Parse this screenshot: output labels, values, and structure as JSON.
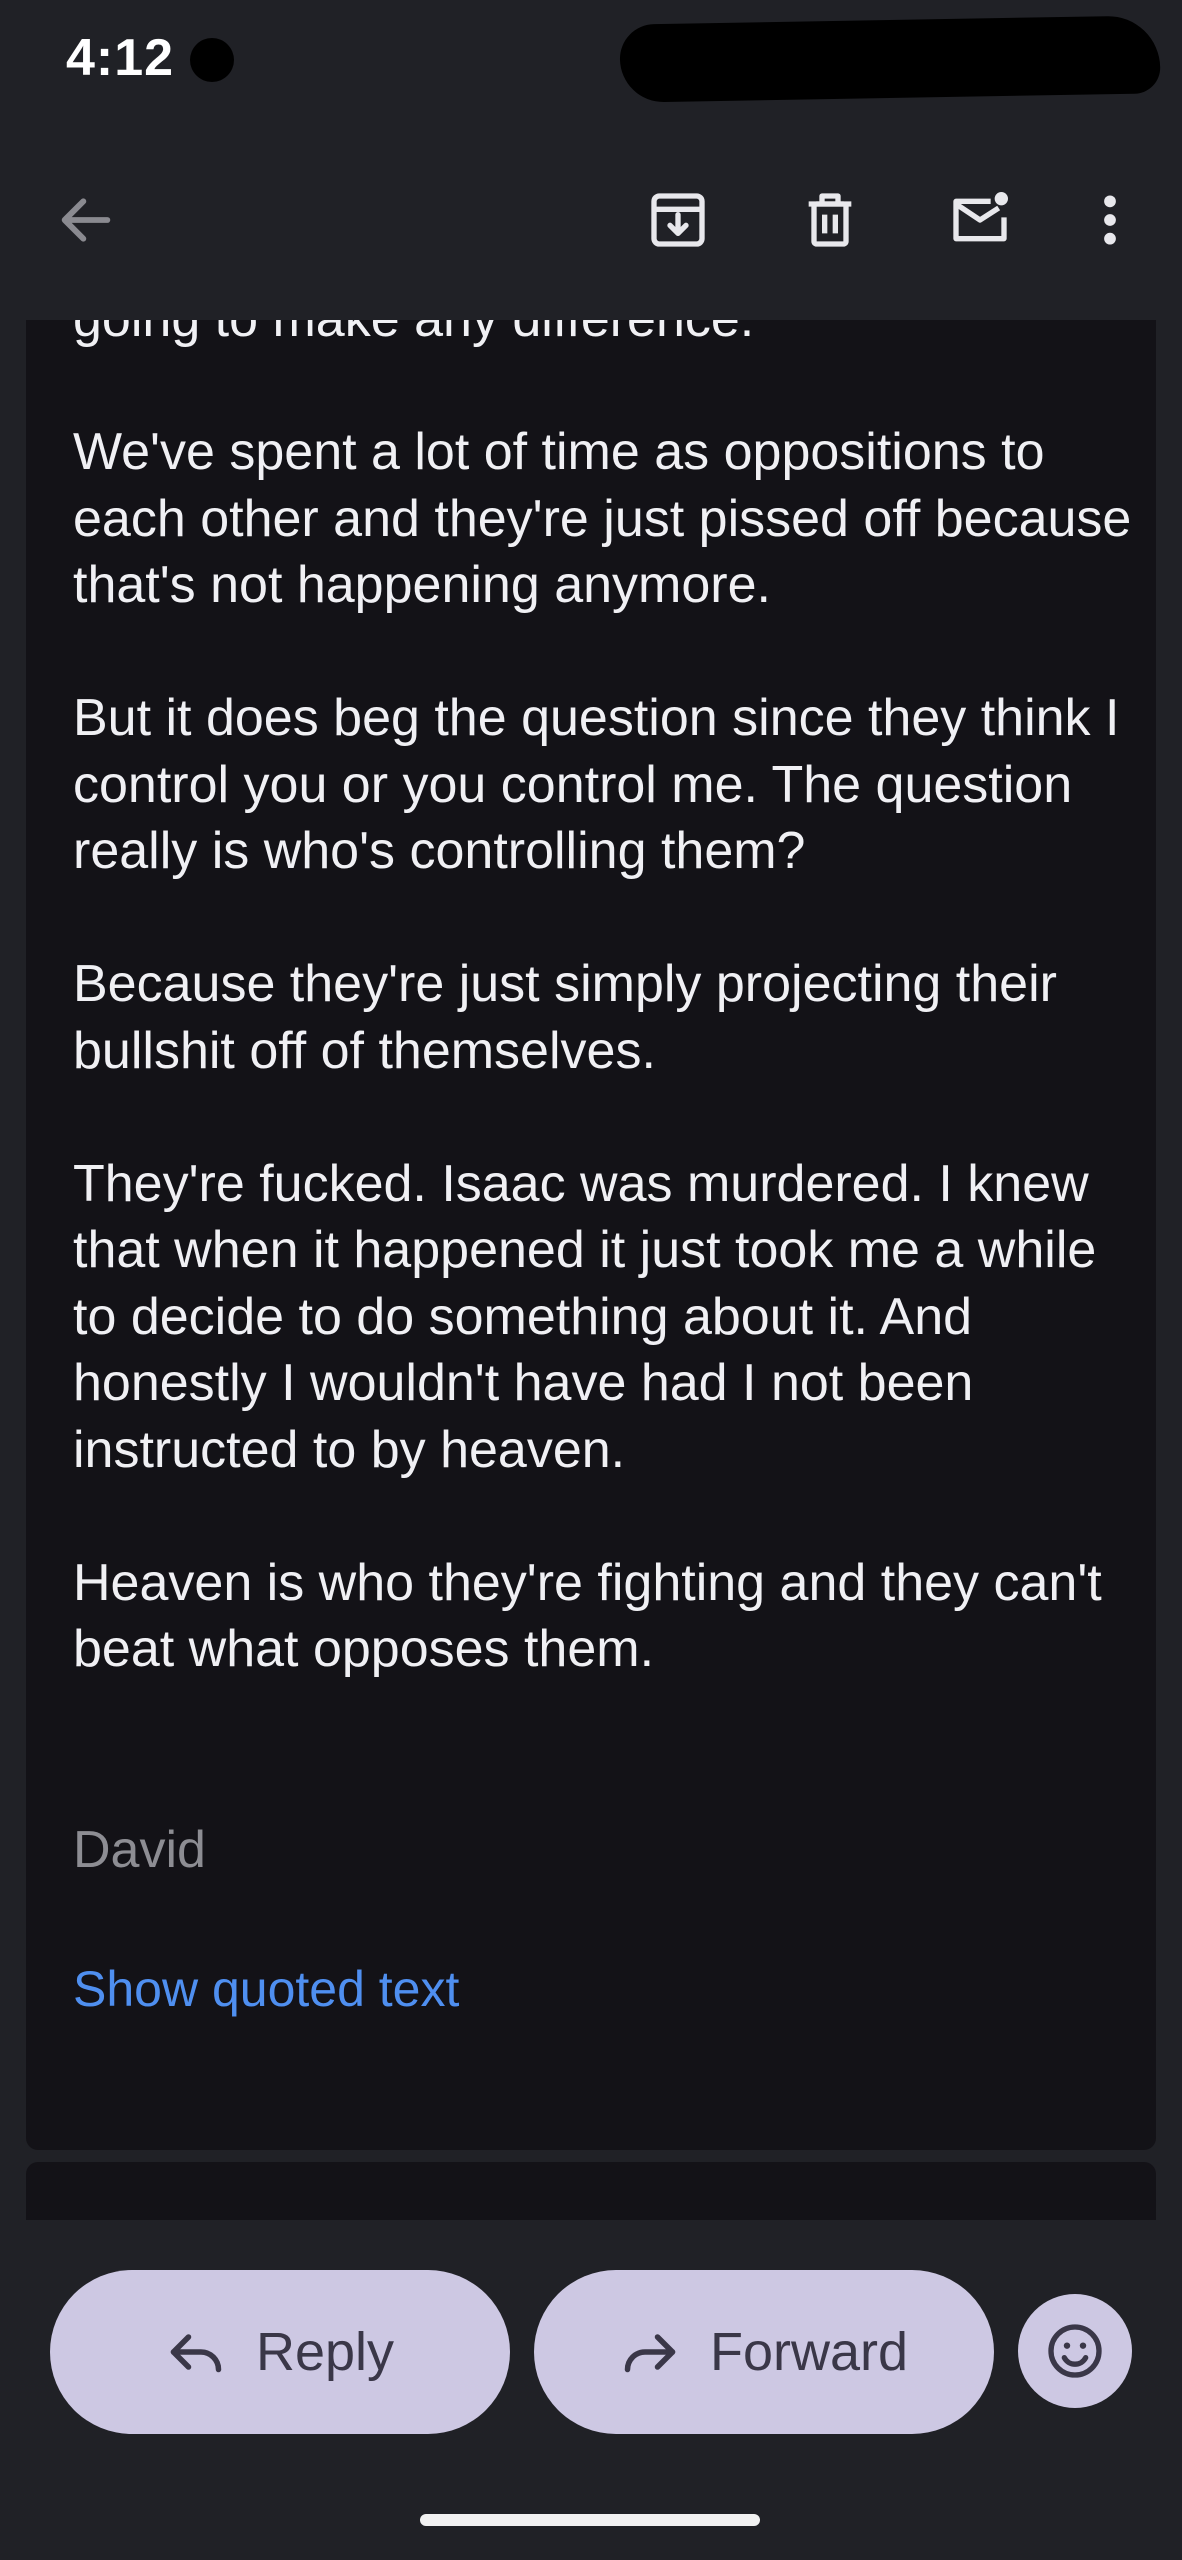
{
  "status_bar": {
    "time": "4:12"
  },
  "toolbar": {
    "back_icon": "arrow-left-icon",
    "archive_icon": "archive-icon",
    "delete_icon": "trash-icon",
    "unread_icon": "mark-unread-icon",
    "more_icon": "more-vertical-icon"
  },
  "message": {
    "partial_line": "going to make any difference.",
    "paragraphs": [
      "We've spent a lot of time as oppositions to each other and they're just pissed off because that's not happening anymore.",
      "But it does beg the question since they think I control you or you control me. The question really is who's controlling them?",
      "Because they're just simply projecting their bullshit off of themselves.",
      "They're fucked. Isaac was murdered. I knew that when it happened it just took me a while to decide to do something about it. And honestly I wouldn't have had I not been instructed to by heaven.",
      "Heaven is who they're fighting and they can't beat what opposes them."
    ],
    "signature": "David",
    "show_quoted_text": "Show quoted text"
  },
  "actions": {
    "reply_label": "Reply",
    "forward_label": "Forward",
    "emoji_icon": "emoji-smile-icon"
  },
  "colors": {
    "background": "#202126",
    "card": "#131217",
    "link": "#4f8ff0",
    "pill": "#cdc8e3"
  }
}
